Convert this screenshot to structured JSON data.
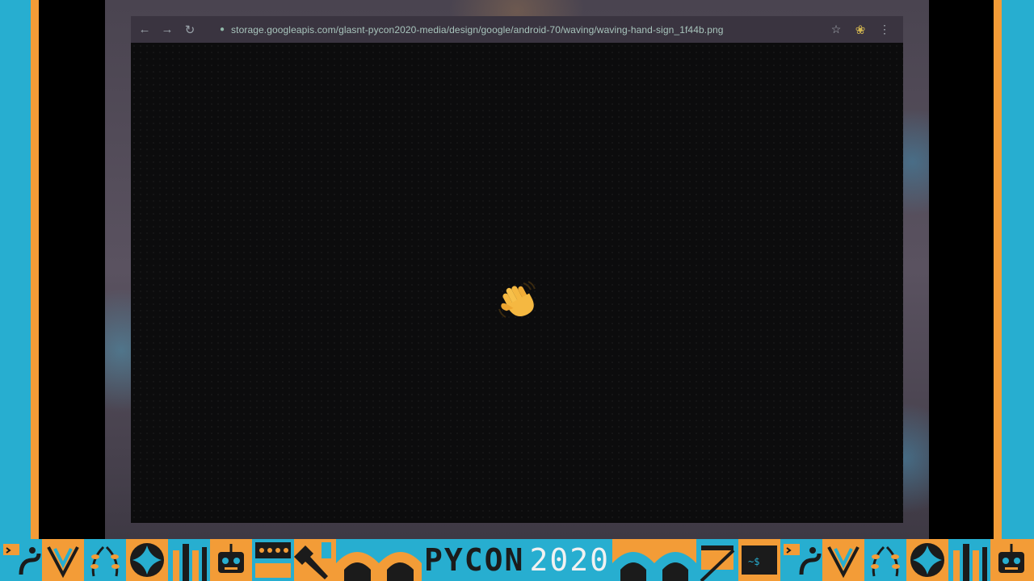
{
  "browser": {
    "url": "storage.googleapis.com/glasnt-pycon2020-media/design/google/android-70/waving/waving-hand-sign_1f44b.png",
    "nav": {
      "back_icon": "arrow-left-icon",
      "forward_icon": "arrow-right-icon",
      "reload_icon": "reload-icon"
    },
    "toolbar_icons": [
      "lock-icon",
      "star-icon",
      "extension-icon",
      "kebab-menu-icon"
    ],
    "image_content": "waving-hand-emoji"
  },
  "banner": {
    "logo_text": "PYCON",
    "logo_year": "2020",
    "colors": {
      "blue": "#27aed0",
      "orange": "#f39c37",
      "dark": "#1b1b1b"
    }
  }
}
